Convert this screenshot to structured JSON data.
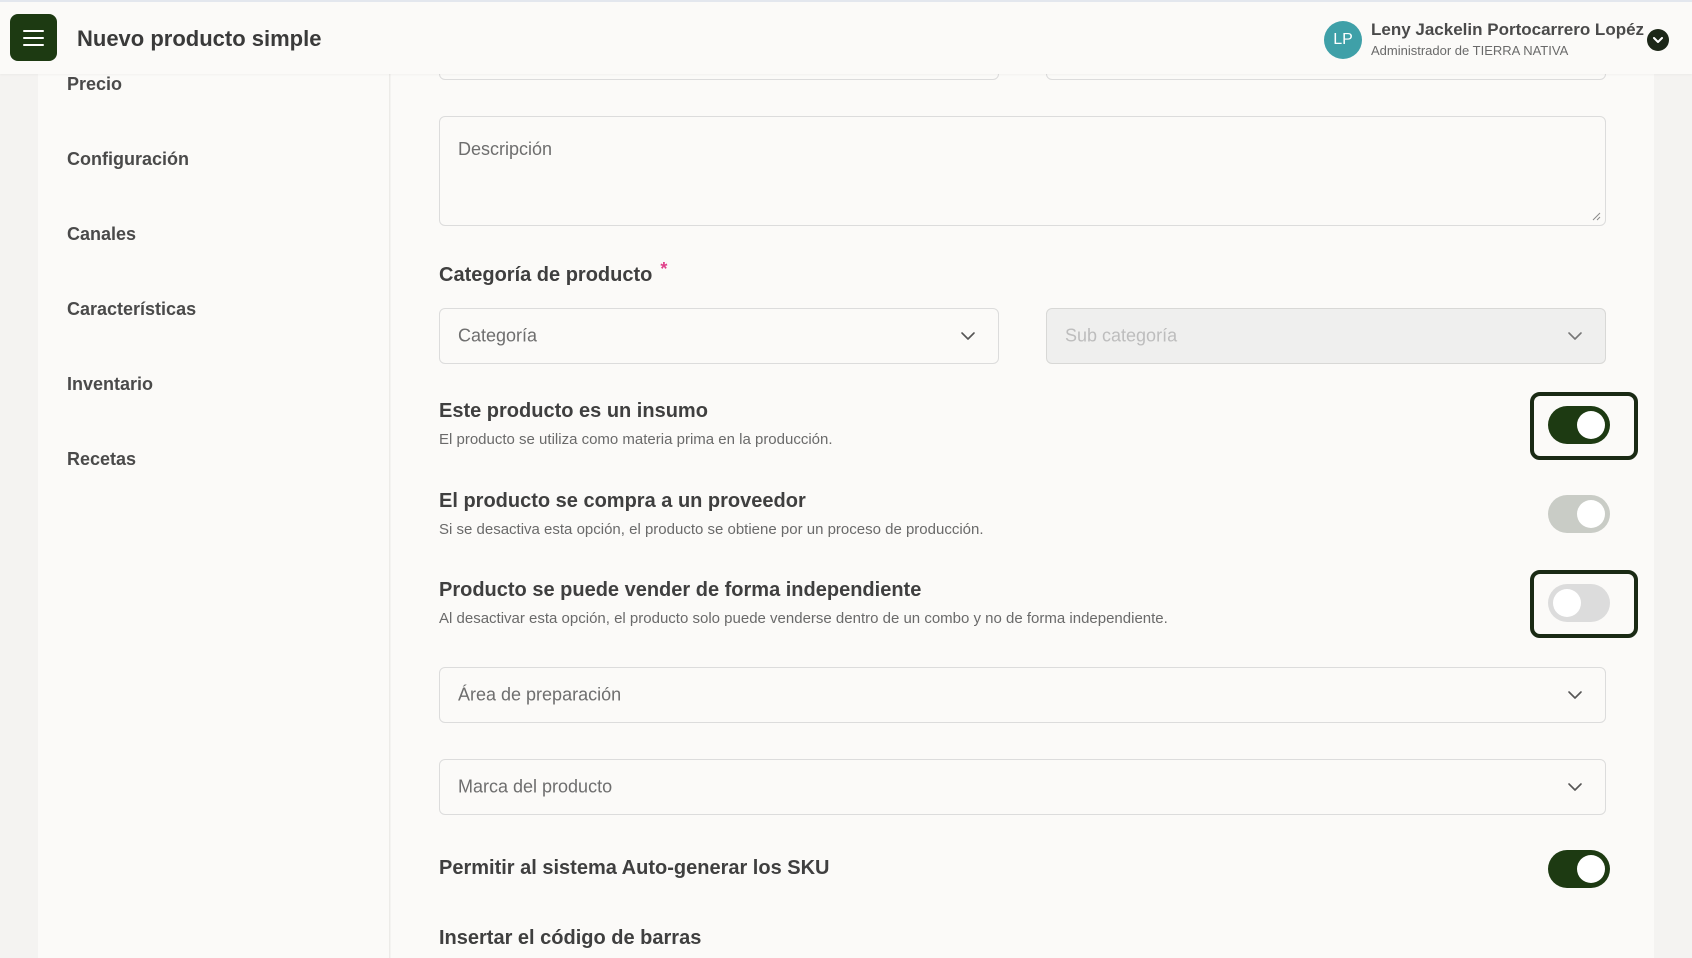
{
  "header": {
    "title": "Nuevo producto simple",
    "user": {
      "initials": "LP",
      "name": "Leny Jackelin Portocarrero Lopéz",
      "role": "Administrador de TIERRA NATIVA"
    }
  },
  "sidebar": {
    "items": [
      {
        "label": "Precio"
      },
      {
        "label": "Configuración"
      },
      {
        "label": "Canales"
      },
      {
        "label": "Características"
      },
      {
        "label": "Inventario"
      },
      {
        "label": "Recetas"
      }
    ]
  },
  "form": {
    "description_placeholder": "Descripción",
    "category_section": {
      "label": "Categoría de producto",
      "required_mark": "*",
      "category_placeholder": "Categoría",
      "subcategory_placeholder": "Sub categoría"
    },
    "options": [
      {
        "title": "Este producto es un insumo",
        "description": "El producto se utiliza como materia prima en la producción.",
        "enabled": true
      },
      {
        "title": "El producto se compra a un proveedor",
        "description": "Si se desactiva esta opción, el producto se obtiene por un proceso de producción.",
        "enabled": true,
        "disabled": true
      },
      {
        "title": "Producto se puede vender de forma independiente",
        "description": "Al desactivar esta opción, el producto solo puede venderse dentro de un combo y no de forma independiente.",
        "enabled": false
      }
    ],
    "prep_area_placeholder": "Área de preparación",
    "brand_placeholder": "Marca del producto",
    "auto_sku": {
      "title": "Permitir al sistema Auto-generar los SKU",
      "enabled": true
    },
    "barcode_label": "Insertar el código de barras"
  },
  "colors": {
    "accent": "#1d3a12",
    "avatar": "#3fa0a8",
    "required": "#e0408a"
  }
}
